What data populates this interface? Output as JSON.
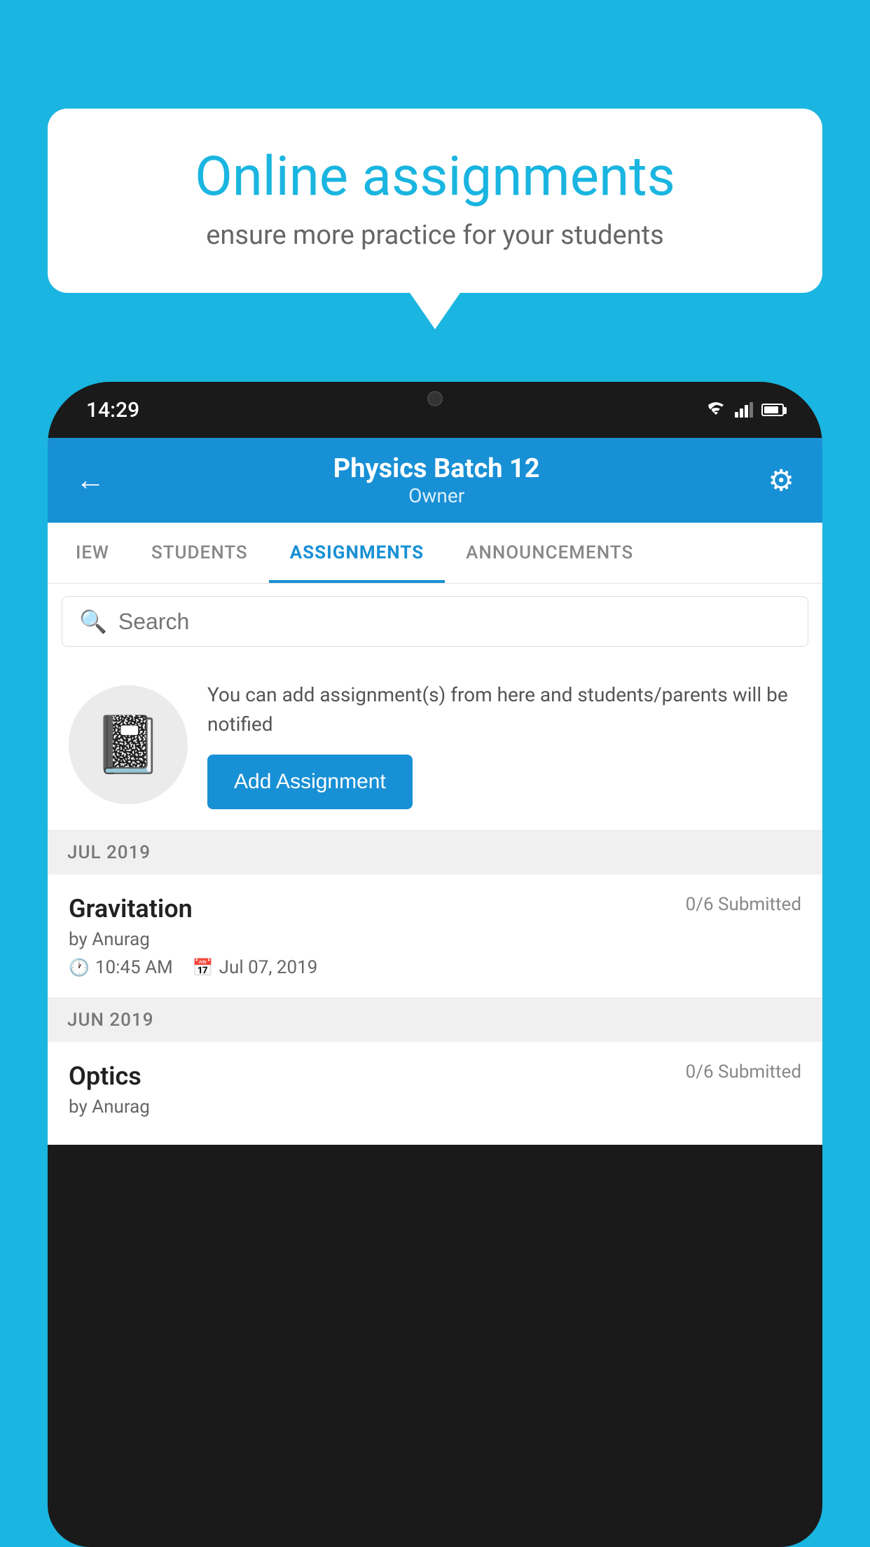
{
  "background": {
    "color": "#1ab5e0"
  },
  "speechBubble": {
    "title": "Online assignments",
    "subtitle": "ensure more practice for your students"
  },
  "phone": {
    "statusBar": {
      "time": "14:29"
    },
    "header": {
      "title": "Physics Batch 12",
      "subtitle": "Owner"
    },
    "tabs": [
      {
        "label": "IEW",
        "active": false
      },
      {
        "label": "STUDENTS",
        "active": false
      },
      {
        "label": "ASSIGNMENTS",
        "active": true
      },
      {
        "label": "ANNOUNCEMENTS",
        "active": false
      }
    ],
    "search": {
      "placeholder": "Search"
    },
    "infoCard": {
      "description": "You can add assignment(s) from here and students/parents will be notified",
      "buttonLabel": "Add Assignment"
    },
    "sections": [
      {
        "header": "JUL 2019",
        "assignments": [
          {
            "name": "Gravitation",
            "submitted": "0/6 Submitted",
            "author": "by Anurag",
            "time": "10:45 AM",
            "date": "Jul 07, 2019"
          }
        ]
      },
      {
        "header": "JUN 2019",
        "assignments": [
          {
            "name": "Optics",
            "submitted": "0/6 Submitted",
            "author": "by Anurag",
            "time": "",
            "date": ""
          }
        ]
      }
    ]
  }
}
